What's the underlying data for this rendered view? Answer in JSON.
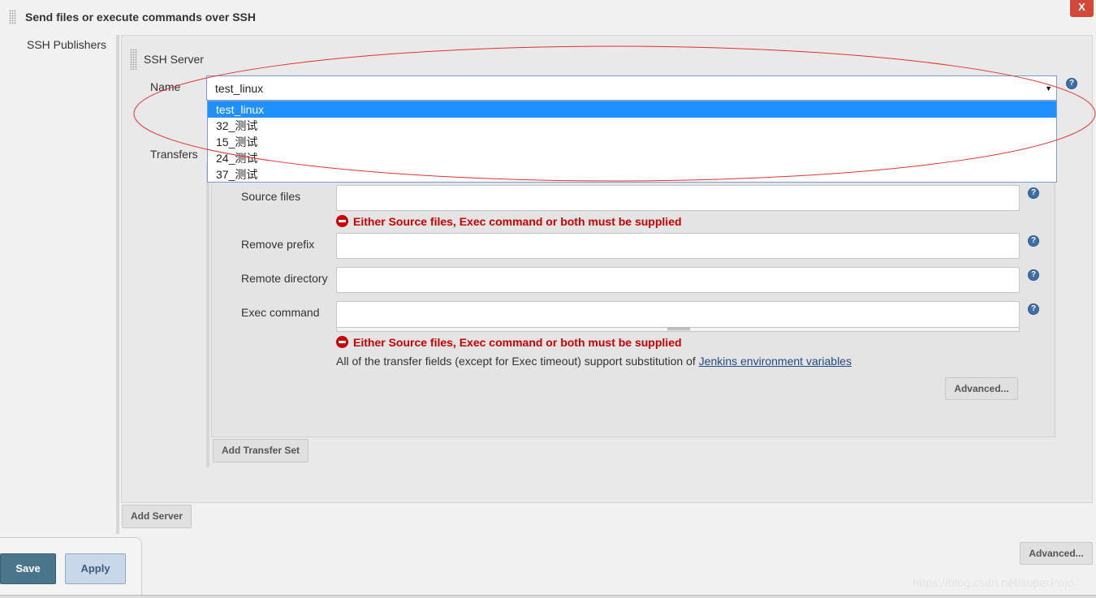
{
  "header": {
    "title": "Send files or execute commands over SSH",
    "close_label": "X"
  },
  "publishers_label": "SSH Publishers",
  "server": {
    "title": "SSH Server",
    "name_label": "Name",
    "name_value": "test_linux",
    "options": [
      "test_linux",
      "32_测试",
      "15_测试",
      "24_测试",
      "37_测试"
    ],
    "transfers_label": "Transfers"
  },
  "transfer": {
    "source_files_label": "Source files",
    "source_files_value": "",
    "remove_prefix_label": "Remove prefix",
    "remove_prefix_value": "",
    "remote_directory_label": "Remote directory",
    "remote_directory_value": "",
    "exec_command_label": "Exec command",
    "exec_command_value": "",
    "error_message": "Either Source files, Exec command or both must be supplied",
    "substitution_note": "All of the transfer fields (except for Exec timeout) support substitution of ",
    "env_vars_link": "Jenkins environment variables",
    "advanced_label": "Advanced...",
    "add_transfer_set_label": "Add Transfer Set"
  },
  "add_server_label": "Add Server",
  "advanced_label": "Advanced...",
  "footer": {
    "save_label": "Save",
    "apply_label": "Apply"
  },
  "watermark": "https://blog.csdn.net/superPojo",
  "help_icon_glyph": "?",
  "colors": {
    "error_red": "#cc0000",
    "selected_option": "#1e90ff",
    "annotation_ellipse": "#e03030",
    "save_button": "#4b758b",
    "link": "#204a87",
    "help_icon": "#3d6ea8"
  }
}
